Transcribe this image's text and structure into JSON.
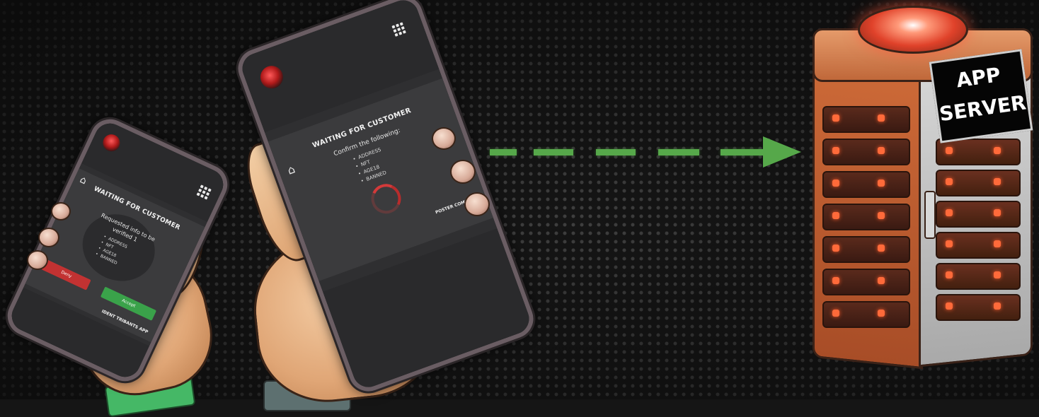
{
  "phone_small": {
    "title": "WAITING FOR CUSTOMER",
    "message_line1": "Requested info to be",
    "message_line2": "verified 1",
    "items": [
      "ADDRESS",
      "NFT",
      "AGE18",
      "BANNED"
    ],
    "deny_label": "Deny",
    "accept_label": "Accept",
    "footer_brand": "IDENT TRIBANTS APP"
  },
  "phone_large": {
    "title": "WAITING FOR CUSTOMER",
    "message": "Confirm the following:",
    "items": [
      "ADDRESS",
      "NFT",
      "AGE18",
      "BANNED"
    ],
    "footer_brand": "POSTER COMPANY"
  },
  "server": {
    "label_line1": "APP",
    "label_line2": "SERVER"
  },
  "colors": {
    "arrow": "#56a84a",
    "accent_red": "#d33a3a",
    "accept_green": "#3aa24a",
    "deny_red": "#c23232"
  },
  "icons": {
    "phone_small_home": "home-icon",
    "phone_small_menu": "grid-menu-icon",
    "phone_large_home": "home-icon",
    "phone_large_menu": "grid-menu-icon"
  }
}
